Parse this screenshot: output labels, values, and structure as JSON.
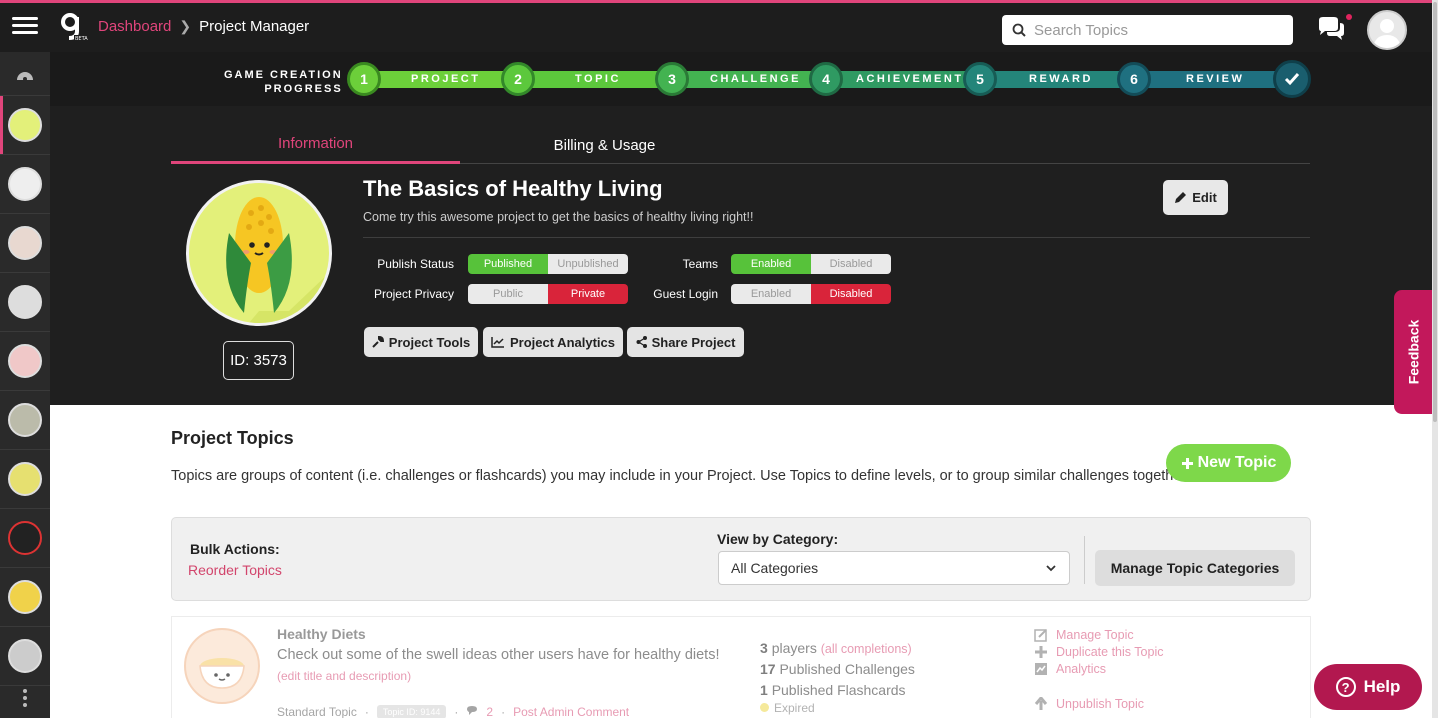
{
  "header": {
    "breadcrumb_root": "Dashboard",
    "breadcrumb_current": "Project Manager",
    "search_placeholder": "Search Topics"
  },
  "progress": {
    "label_line1": "GAME CREATION",
    "label_line2": "PROGRESS",
    "steps": [
      {
        "num": "1",
        "name": "PROJECT",
        "color": "#6ccf3a"
      },
      {
        "num": "2",
        "name": "TOPIC",
        "color": "#5cc83c"
      },
      {
        "num": "3",
        "name": "CHALLENGE",
        "color": "#43b351"
      },
      {
        "num": "4",
        "name": "ACHIEVEMENT",
        "color": "#2f9a62"
      },
      {
        "num": "5",
        "name": "REWARD",
        "color": "#24857a"
      },
      {
        "num": "6",
        "name": "REVIEW",
        "color": "#1f7080"
      }
    ]
  },
  "tabs": [
    "Information",
    "Billing & Usage"
  ],
  "project": {
    "title": "The Basics of Healthy Living",
    "description": "Come try this awesome project to get the basics of healthy living right!!",
    "id_label": "ID: 3573",
    "edit_label": "Edit"
  },
  "settings": {
    "publish_status": {
      "label": "Publish Status",
      "on": "Published",
      "off": "Unpublished"
    },
    "project_privacy": {
      "label": "Project Privacy",
      "a": "Public",
      "b": "Private"
    },
    "teams": {
      "label": "Teams",
      "on": "Enabled",
      "off": "Disabled"
    },
    "guest_login": {
      "label": "Guest Login",
      "a": "Enabled",
      "b": "Disabled"
    }
  },
  "tools": {
    "project_tools": "Project Tools",
    "project_analytics": "Project Analytics",
    "share_project": "Share Project"
  },
  "feedback_label": "Feedback",
  "topics": {
    "title": "Project Topics",
    "description": "Topics are groups of content (i.e. challenges or flashcards) you may include in your Project. Use Topics to define levels, or to group similar challenges together.",
    "new_topic": "New Topic",
    "bulk_title": "Bulk Actions:",
    "reorder": "Reorder Topics",
    "view_by": "View by Category:",
    "category_selected": "All Categories",
    "manage_categories": "Manage Topic Categories"
  },
  "topic_row": {
    "name": "Healthy Diets",
    "description": "Check out some of the swell ideas other users have for healthy diets!",
    "edit_link": "(edit title and description)",
    "type": "Standard Topic",
    "topic_id": "Topic ID: 9144",
    "comment_count": "2",
    "post_comment": "Post Admin Comment",
    "players_num": "3",
    "players_label": "players",
    "all_completions": "(all completions)",
    "challenges_num": "17",
    "challenges_label": "Published Challenges",
    "flashcards_num": "1",
    "flashcards_label": "Published Flashcards",
    "expired": "Expired",
    "actions": {
      "manage": "Manage Topic",
      "duplicate": "Duplicate this Topic",
      "analytics": "Analytics",
      "unpublish": "Unpublish Topic"
    }
  },
  "help_label": "Help"
}
